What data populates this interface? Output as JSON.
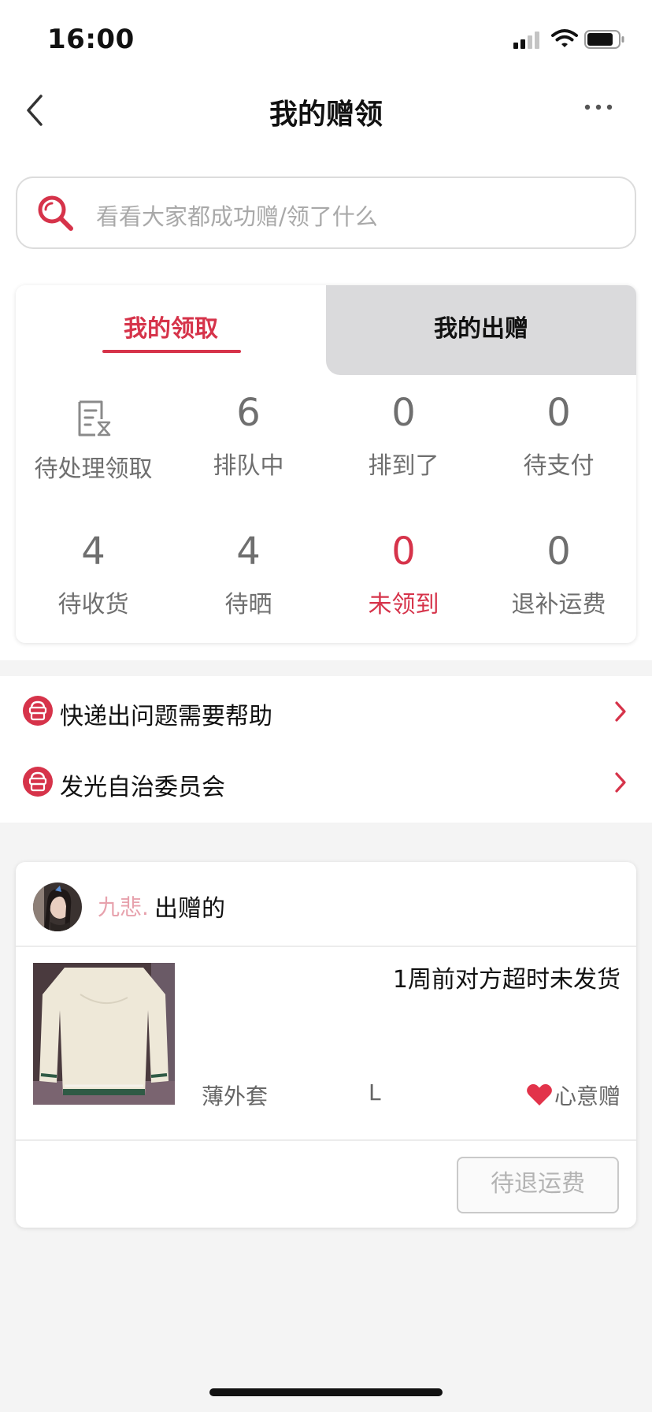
{
  "status_bar": {
    "time": "16:00"
  },
  "nav": {
    "title": "我的赠领"
  },
  "search": {
    "placeholder": "看看大家都成功赠/领了什么"
  },
  "tabs": [
    {
      "label": "我的领取",
      "active": true
    },
    {
      "label": "我的出赠",
      "active": false
    }
  ],
  "stats": [
    {
      "value": "",
      "label": "待处理领取",
      "icon": "receipt-hourglass-icon"
    },
    {
      "value": "6",
      "label": "排队中"
    },
    {
      "value": "0",
      "label": "排到了"
    },
    {
      "value": "0",
      "label": "待支付"
    },
    {
      "value": "4",
      "label": "待收货"
    },
    {
      "value": "4",
      "label": "待晒"
    },
    {
      "value": "0",
      "label": "未领到",
      "highlight": true
    },
    {
      "value": "0",
      "label": "退补运费"
    }
  ],
  "help_items": [
    {
      "label": "快递出问题需要帮助",
      "icon": "service-icon"
    },
    {
      "label": "发光自治委员会",
      "icon": "service-icon"
    }
  ],
  "order": {
    "giver_name": "九悲.",
    "giver_suffix": "出赠的",
    "status": "1周前对方超时未发货",
    "product_name": "薄外套",
    "size": "L",
    "gift_type": "心意赠",
    "action_button": "待退运费"
  },
  "colors": {
    "accent": "#d6334a",
    "muted_text": "#6f6f6f",
    "tab_inactive_bg": "#dadadc",
    "page_bg": "#f4f4f4"
  }
}
